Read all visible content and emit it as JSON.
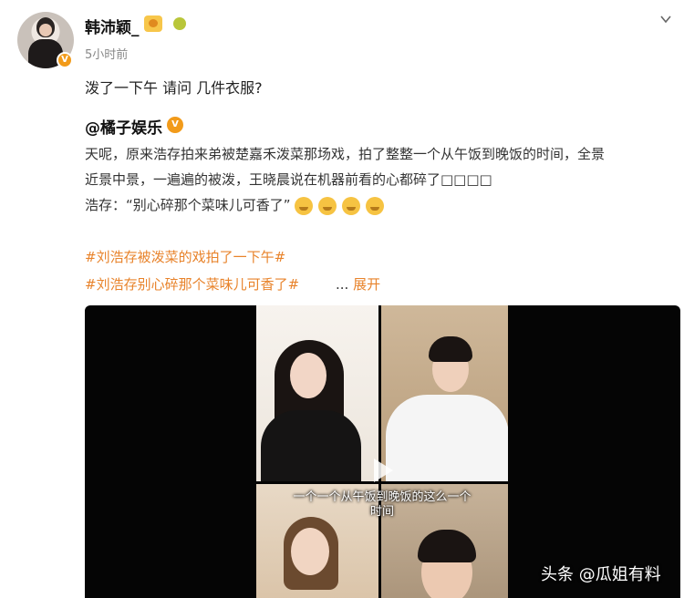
{
  "post": {
    "author": "韩沛颖_",
    "timestamp": "5小时前",
    "text": "泼了一下午 请问 几件衣服?"
  },
  "repost": {
    "author": "@橘子娱乐",
    "lines": [
      "天呢，原来浩存拍来弟被楚嘉禾泼菜那场戏，拍了整整一个从午饭到晚饭的时间，全景",
      "近景中景，一遍遍的被泼，王晓晨说在机器前看的心都碎了□□□□"
    ],
    "quote": "浩存：“别心碎那个菜味儿可香了”",
    "hashtags": [
      "#刘浩存被泼菜的戏拍了一下午#",
      "#刘浩存别心碎那个菜味儿可香了#"
    ],
    "ellipsis": "...",
    "expand_label": "展开"
  },
  "video": {
    "subtitle_line1": "一个一个从午饭到晚饭的这么一个",
    "subtitle_line2": "时间"
  },
  "watermark": "头条 @瓜姐有料",
  "icons": {
    "avatar": "avatar",
    "verified": "verified-badge-icon",
    "menu": "chevron-down-icon",
    "play": "play-icon",
    "emoji": "smile-emoji-icon"
  },
  "colors": {
    "hashtag": "#e8832b",
    "verified": "#f29b1a"
  }
}
